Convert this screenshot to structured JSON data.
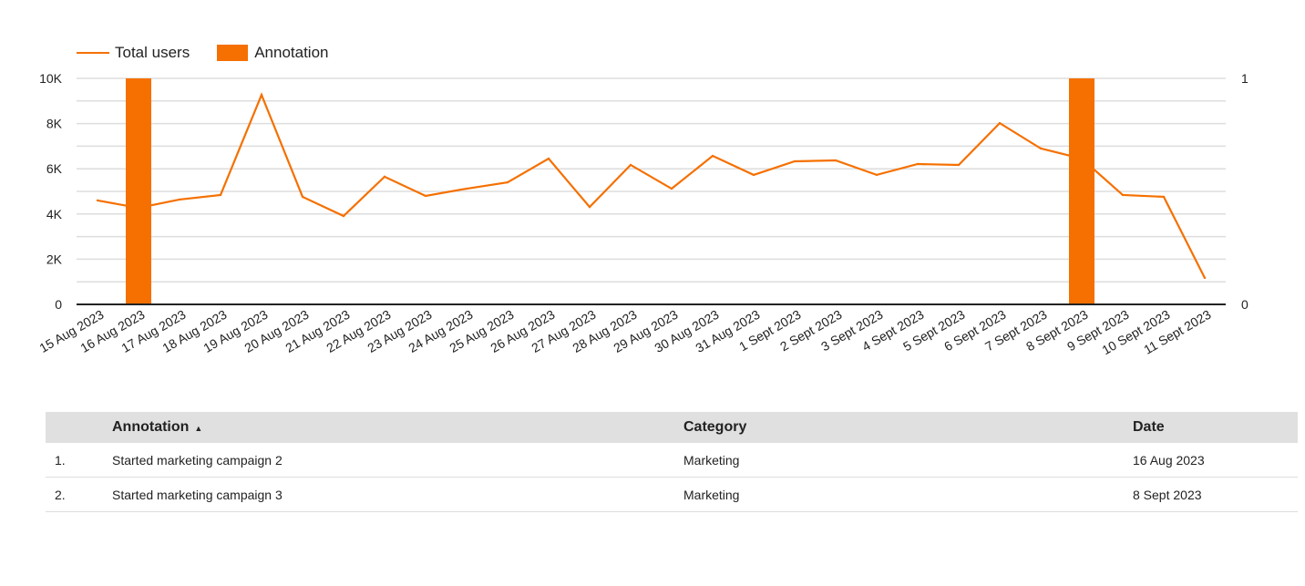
{
  "chart_data": {
    "type": "line",
    "x": [
      "15 Aug 2023",
      "16 Aug 2023",
      "17 Aug 2023",
      "18 Aug 2023",
      "19 Aug 2023",
      "20 Aug 2023",
      "21 Aug 2023",
      "22 Aug 2023",
      "23 Aug 2023",
      "24 Aug 2023",
      "25 Aug 2023",
      "26 Aug 2023",
      "27 Aug 2023",
      "28 Aug 2023",
      "29 Aug 2023",
      "30 Aug 2023",
      "31 Aug 2023",
      "1 Sept 2023",
      "2 Sept 2023",
      "3 Sept 2023",
      "4 Sept 2023",
      "5 Sept 2023",
      "6 Sept 2023",
      "7 Sept 2023",
      "8 Sept 2023",
      "9 Sept 2023",
      "10 Sept 2023",
      "11 Sept 2023"
    ],
    "series": [
      {
        "name": "Total users",
        "type": "line",
        "axis": "left",
        "values": [
          4600,
          4270,
          4640,
          4840,
          9270,
          4760,
          3910,
          5650,
          4800,
          5120,
          5400,
          6450,
          4310,
          6170,
          5120,
          6570,
          5730,
          6330,
          6370,
          5730,
          6210,
          6170,
          8020,
          6900,
          6450,
          4840,
          4760,
          1170
        ]
      },
      {
        "name": "Annotation",
        "type": "bar",
        "axis": "right",
        "values": [
          0,
          1,
          0,
          0,
          0,
          0,
          0,
          0,
          0,
          0,
          0,
          0,
          0,
          0,
          0,
          0,
          0,
          0,
          0,
          0,
          0,
          0,
          0,
          0,
          1,
          0,
          0,
          0
        ]
      }
    ],
    "left_axis": {
      "ticks": [
        "0",
        "2K",
        "4K",
        "6K",
        "8K",
        "10K"
      ],
      "range": [
        0,
        10000
      ]
    },
    "right_axis": {
      "ticks": [
        "0",
        "1"
      ],
      "range": [
        0,
        1
      ]
    },
    "grid": true,
    "legend": "top-left",
    "color": "#f57000"
  },
  "table": {
    "headers": [
      "Annotation",
      "Category",
      "Date"
    ],
    "sort_indicator": "▲",
    "rows": [
      {
        "num": "1.",
        "annotation": "Started marketing campaign 2",
        "category": "Marketing",
        "date": "16 Aug 2023"
      },
      {
        "num": "2.",
        "annotation": "Started marketing campaign 3",
        "category": "Marketing",
        "date": "8 Sept 2023"
      }
    ]
  }
}
